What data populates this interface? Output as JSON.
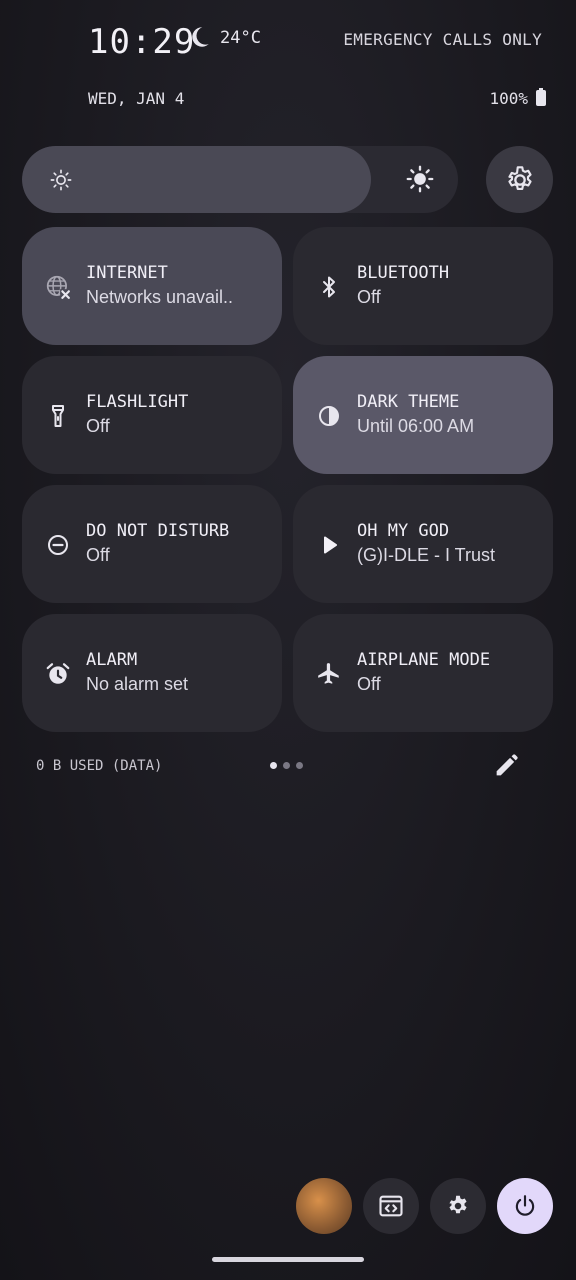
{
  "status": {
    "time": "10:29",
    "weather_icon": "moon-icon",
    "temperature": "24°C",
    "network": "EMERGENCY CALLS ONLY",
    "date": "WED, JAN 4",
    "battery": "100%"
  },
  "brightness": {
    "level_percent": 80
  },
  "tiles": [
    {
      "title": "INTERNET",
      "subtitle": "Networks unavail..",
      "icon": "globe-off-icon",
      "state": "active"
    },
    {
      "title": "BLUETOOTH",
      "subtitle": "Off",
      "icon": "bluetooth-icon",
      "state": "off"
    },
    {
      "title": "FLASHLIGHT",
      "subtitle": "Off",
      "icon": "flashlight-icon",
      "state": "off"
    },
    {
      "title": "DARK THEME",
      "subtitle": "Until 06:00 AM",
      "icon": "contrast-icon",
      "state": "active"
    },
    {
      "title": "DO NOT DISTURB",
      "subtitle": "Off",
      "icon": "dnd-icon",
      "state": "off"
    },
    {
      "title": "OH MY GOD",
      "subtitle": "(G)I-DLE - I Trust",
      "icon": "play-icon",
      "state": "off"
    },
    {
      "title": "ALARM",
      "subtitle": "No alarm set",
      "icon": "alarm-icon",
      "state": "off"
    },
    {
      "title": "AIRPLANE MODE",
      "subtitle": "Off",
      "icon": "airplane-icon",
      "state": "off"
    }
  ],
  "footer": {
    "data_used": "0 B USED (DATA)",
    "page_count": 3,
    "current_page": 1
  },
  "colors": {
    "background": "#1b1a20",
    "tile_off": "#2a2930",
    "tile_active": "#4a4956",
    "power_button": "#e2d8fa"
  }
}
